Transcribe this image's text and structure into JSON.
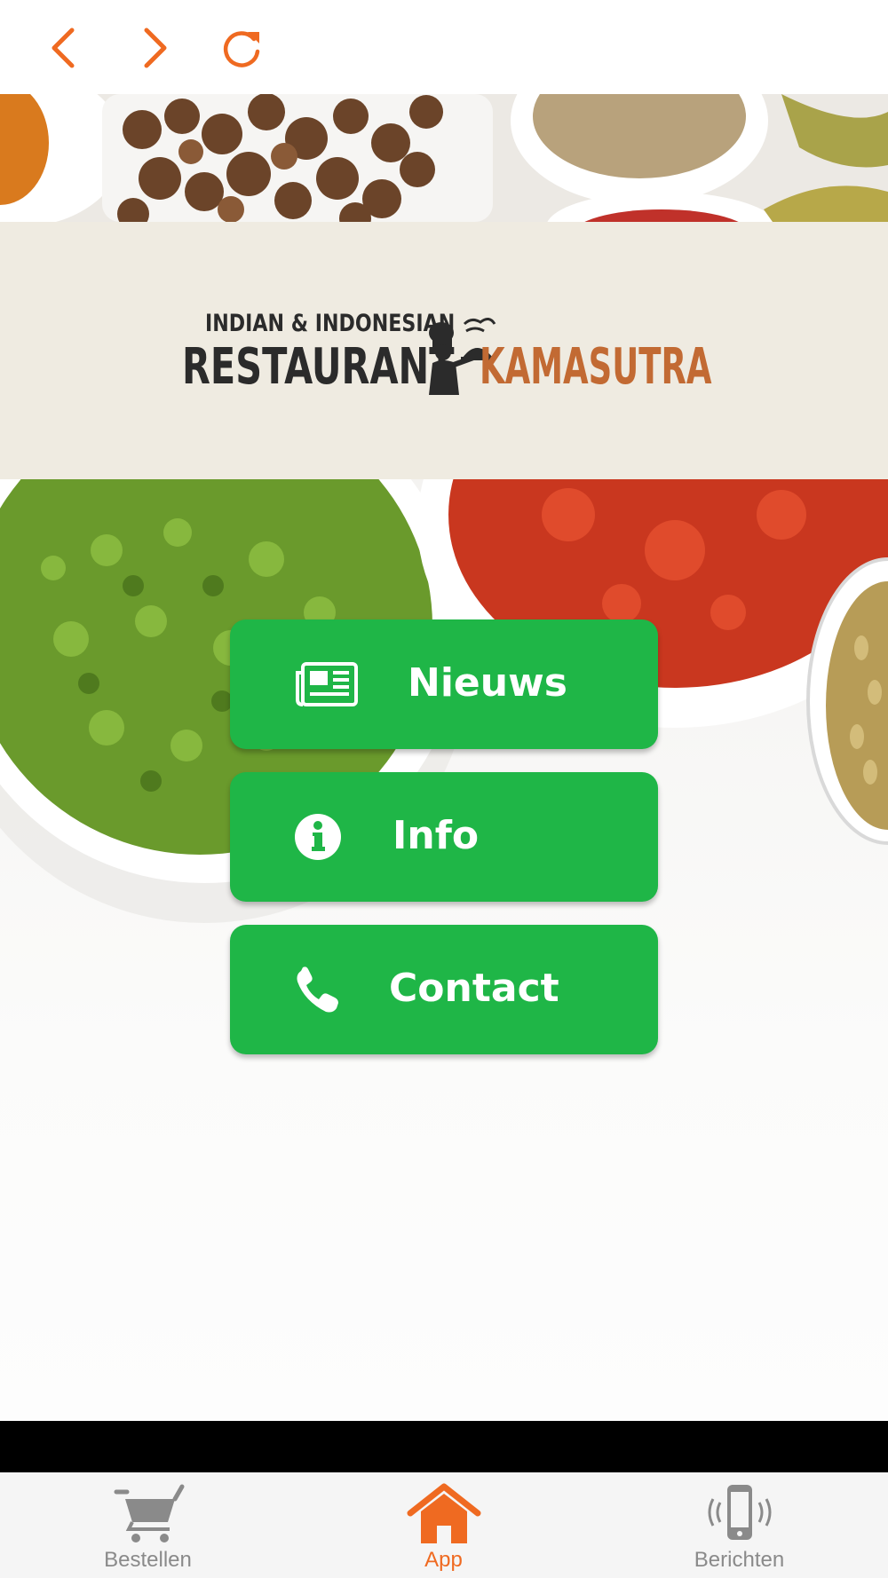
{
  "nav": {
    "back_icon": "chevron-left-icon",
    "forward_icon": "chevron-right-icon",
    "reload_icon": "reload-icon",
    "accent": "#ef6a21"
  },
  "logo": {
    "line1": "INDIAN & INDONESIAN",
    "line2": "RESTAURANT",
    "line3": "KAMASUTRA"
  },
  "menu": {
    "button_color": "#1fb647",
    "items": [
      {
        "label": "Nieuws",
        "icon": "newspaper-icon"
      },
      {
        "label": "Info",
        "icon": "info-icon"
      },
      {
        "label": "Contact",
        "icon": "phone-icon"
      }
    ]
  },
  "tabbar": {
    "items": [
      {
        "label": "Bestellen",
        "icon": "cart-icon",
        "active": false
      },
      {
        "label": "App",
        "icon": "home-icon",
        "active": true
      },
      {
        "label": "Berichten",
        "icon": "phone-vibrate-icon",
        "active": false
      }
    ],
    "active_color": "#ef6a21",
    "inactive_color": "#8a8a8a"
  }
}
